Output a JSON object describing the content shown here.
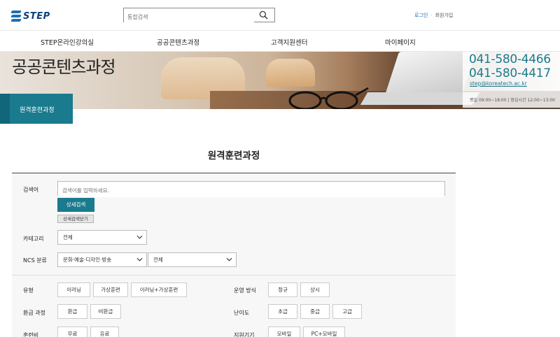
{
  "header": {
    "logo_text": "STEP",
    "search_placeholder": "통합검색",
    "login_label": "로그인",
    "separator": "·",
    "join_label": "회원가입"
  },
  "nav": {
    "items": [
      {
        "label": "STEP온라인강의실"
      },
      {
        "label": "공공콘텐츠과정"
      },
      {
        "label": "고객지원센터"
      },
      {
        "label": "마이페이지"
      }
    ]
  },
  "banner": {
    "page_title": "공공콘텐츠과정",
    "sub_tab_label": "원격훈련과정",
    "phone1": "041-580-4466",
    "phone2": "041-580-4417",
    "email": "step@koreatech.ac.kr",
    "hours": "평일 09:00~18:00  |  점심시간 12:00~13:00"
  },
  "main": {
    "section_title": "원격훈련과정",
    "keyword_label": "검색어",
    "keyword_placeholder": "검색어를 입력하세요.",
    "detail_search_label": "상세검색",
    "close_detail_label": "상세검색닫기",
    "category_label": "카테고리",
    "category_value": "전체",
    "ncs_label": "NCS 분류",
    "ncs_value1": "문화·예술·디자인·방송",
    "ncs_value2": "전체",
    "type_label": "유형",
    "type_options": [
      "이러닝",
      "가상훈련",
      "이러닝+가상훈련"
    ],
    "method_label": "운영 방식",
    "method_options": [
      "정규",
      "상시"
    ],
    "refund_label": "환급 과정",
    "refund_options": [
      "환급",
      "비환급"
    ],
    "level_label": "난이도",
    "level_options": [
      "초급",
      "중급",
      "고급"
    ],
    "fee_label": "훈련비",
    "fee_options": [
      "무료",
      "유료"
    ],
    "device_label": "지원기기",
    "device_options": [
      "모바일",
      "PC+모바일"
    ]
  },
  "colors": {
    "accent": "#1a7a8e",
    "brand": "#1c6fb5"
  }
}
